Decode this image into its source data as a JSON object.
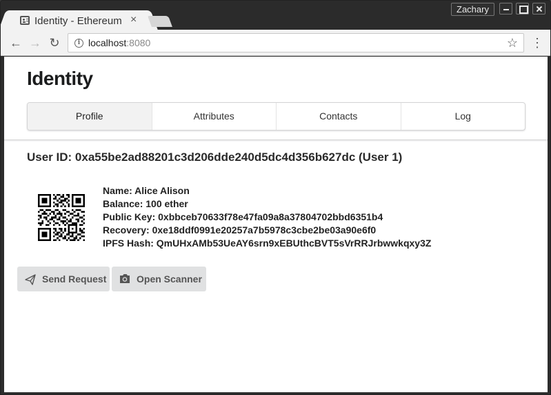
{
  "browser": {
    "tab_title": "Identity - Ethereum",
    "tab_close": "×",
    "profile_name": "Zachary",
    "url_host": "localhost",
    "url_port": ":8080"
  },
  "app": {
    "title": "Identity",
    "menu": [
      {
        "label": "Profile",
        "active": true
      },
      {
        "label": "Attributes"
      },
      {
        "label": "Contacts"
      },
      {
        "label": "Log"
      }
    ]
  },
  "profile": {
    "user_id": "User ID: 0xa55be2ad88201c3d206dde240d5dc4d356b627dc (User 1)",
    "name": "Name: Alice Alison",
    "balance": "Balance: 100 ether",
    "public_key": "Public Key: 0xbbceb70633f78e47fa09a8a37804702bbd6351b4",
    "recovery": "Recovery: 0xe18ddf0991e20257a7b5978c3cbe2be03a90e6f0",
    "ipfs_hash": "IPFS Hash: QmUHxAMb53UeAY6srn9xEBUthcBVT5sVrRRJrbwwkqxy3Z"
  },
  "actions": {
    "send_request": "Send Request",
    "open_scanner": "Open Scanner"
  },
  "icons": {
    "tab": "id-card-icon",
    "send": "paper-plane-icon",
    "scan": "camera-icon",
    "qr": "qr-code-icon"
  }
}
